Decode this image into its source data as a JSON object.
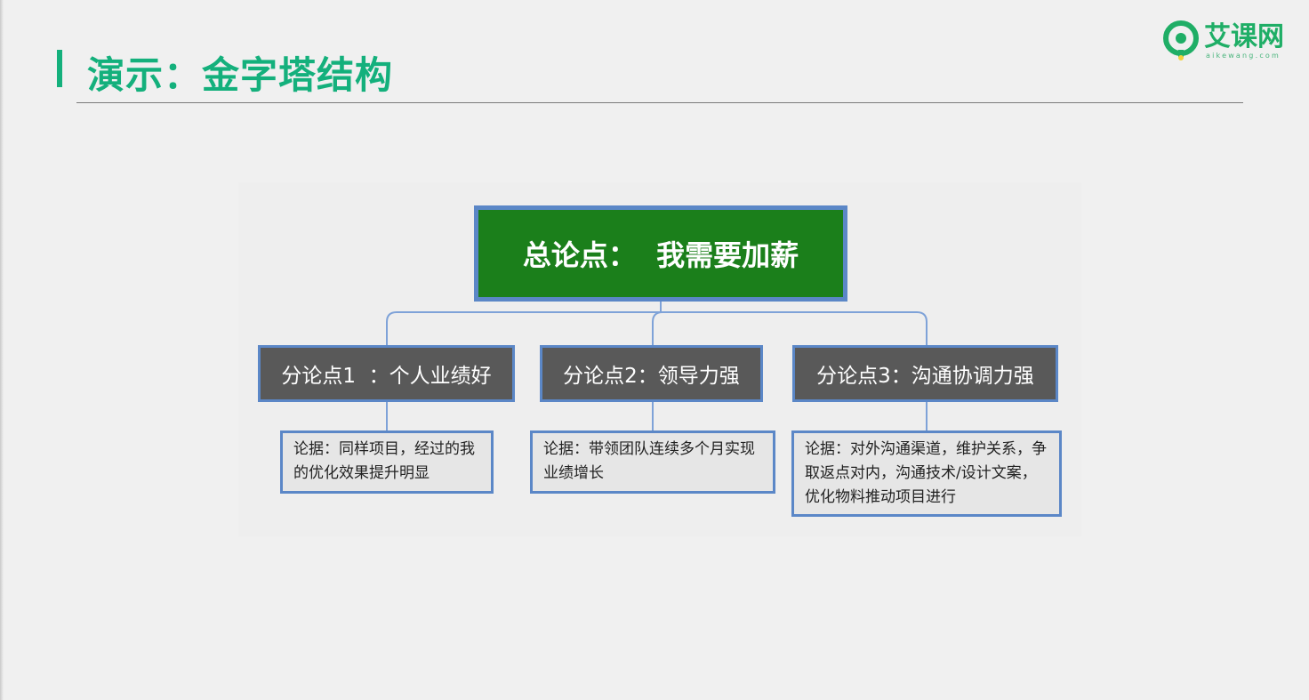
{
  "slide": {
    "title": "演示：金字塔结构"
  },
  "logo": {
    "name": "艾课网",
    "domain": "aikewang.com"
  },
  "colors": {
    "accent": "#14b07c",
    "root_fill": "#1b7f1b",
    "sub_fill": "#595959",
    "box_border": "#5b87c7",
    "connector": "#7ea2d8"
  },
  "pyramid": {
    "root": {
      "label": "总论点：  我需要加薪"
    },
    "points": [
      {
        "label": "分论点1  ：个人业绩好",
        "evidence": "论据：同样项目，经过的我的优化效果提升明显"
      },
      {
        "label": "分论点2：领导力强",
        "evidence": "论据：带领团队连续多个月实现业绩增长"
      },
      {
        "label": "分论点3：沟通协调力强",
        "evidence": "论据：对外沟通渠道，维护关系，争取返点对内，沟通技术/设计文案， 优化物料推动项目进行"
      }
    ]
  }
}
